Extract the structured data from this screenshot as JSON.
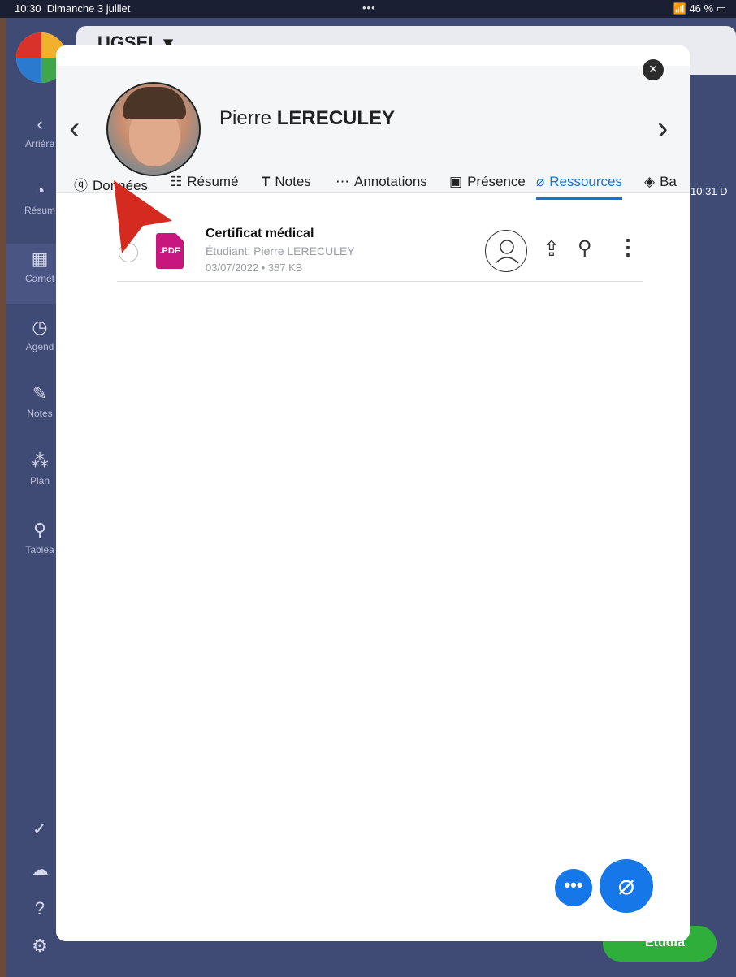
{
  "status_bar": {
    "time": "10:30",
    "date": "Dimanche 3 juillet",
    "dots": "•••",
    "battery": "46 %"
  },
  "background_app": {
    "title": "UGSEL ▾"
  },
  "sidebar": {
    "items": [
      {
        "label": "Arrière",
        "icon": "chevron-left-icon",
        "glyph": "‹"
      },
      {
        "label": "Résum",
        "icon": "pie-chart-icon",
        "glyph": "◔"
      },
      {
        "label": "Carnet",
        "icon": "grid-icon",
        "glyph": "▦"
      },
      {
        "label": "Agend",
        "icon": "clock-icon",
        "glyph": "◷"
      },
      {
        "label": "Notes",
        "icon": "pencil-icon",
        "glyph": "✎"
      },
      {
        "label": "Plan",
        "icon": "people-icon",
        "glyph": "⁂"
      },
      {
        "label": "Tablea",
        "icon": "pin-icon",
        "glyph": "⚲"
      }
    ],
    "bottom_icons": [
      "✓",
      "☁",
      "?",
      "⚙"
    ]
  },
  "screen2": {
    "time": "10:31 D",
    "items": [
      "Arrière",
      "Résum",
      "Carnet",
      "Agend",
      "Notes",
      "Plan",
      "Tablea"
    ]
  },
  "modal": {
    "student_first": "Pierre",
    "student_last": "LERECULEY",
    "close_glyph": "×",
    "prev_glyph": "‹",
    "next_glyph": "›",
    "tabs": [
      {
        "label": "Données",
        "icon": "person-circle-icon",
        "glyph": "ⓠ"
      },
      {
        "label": "Résumé",
        "icon": "summary-icon",
        "glyph": "☷"
      },
      {
        "label": "Notes",
        "icon": "text-icon",
        "glyph": "T"
      },
      {
        "label": "Annotations",
        "icon": "annotation-icon",
        "glyph": "⋯"
      },
      {
        "label": "Présence",
        "icon": "calendar-check-icon",
        "glyph": "▣"
      },
      {
        "label": "Ressources",
        "icon": "paperclip-icon",
        "glyph": "⌀",
        "active": true
      },
      {
        "label": "Ba",
        "icon": "badge-icon",
        "glyph": "◈"
      }
    ],
    "resource": {
      "title": "Certificat médical",
      "student": "Étudiant: Pierre LERECULEY",
      "meta": "03/07/2022 • 387 KB",
      "file_type": ".PDF"
    },
    "fab_more_glyph": "•••",
    "fab_attach_glyph": "⌀"
  },
  "student_pill": {
    "label": "Étudia"
  }
}
